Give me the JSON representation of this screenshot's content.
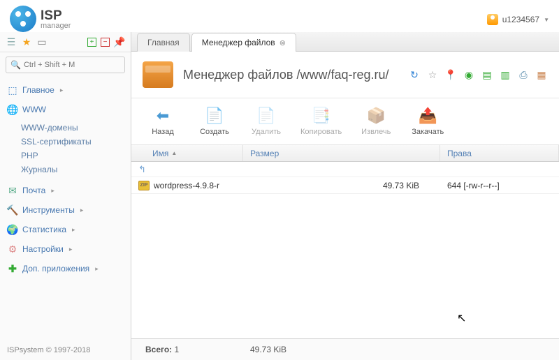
{
  "logo": {
    "brand_bold": "ISP",
    "brand_sub": "manager"
  },
  "user": {
    "name": "u1234567"
  },
  "search": {
    "placeholder": "Ctrl + Shift + M"
  },
  "nav": {
    "main": "Главное",
    "www": "WWW",
    "www_sub": {
      "domains": "WWW-домены",
      "ssl": "SSL-сертификаты",
      "php": "PHP",
      "logs": "Журналы"
    },
    "mail": "Почта",
    "tools": "Инструменты",
    "stats": "Статистика",
    "settings": "Настройки",
    "addons": "Доп. приложения"
  },
  "tabs": {
    "home": "Главная",
    "filemgr": "Менеджер файлов"
  },
  "page_title": "Менеджер файлов /www/faq-reg.ru/",
  "toolbar": {
    "back": "Назад",
    "create": "Создать",
    "delete": "Удалить",
    "copy": "Копировать",
    "extract": "Извлечь",
    "upload": "Закачать"
  },
  "columns": {
    "name": "Имя",
    "size": "Размер",
    "perms": "Права"
  },
  "file": {
    "name": "wordpress-4.9.8-r",
    "size": "49.73 KiB",
    "perms": "644 [-rw-r--r--]"
  },
  "status": {
    "total_label": "Всего:",
    "total_count": "1",
    "total_size": "49.73 KiB"
  },
  "footer": "ISPsystem © 1997-2018"
}
